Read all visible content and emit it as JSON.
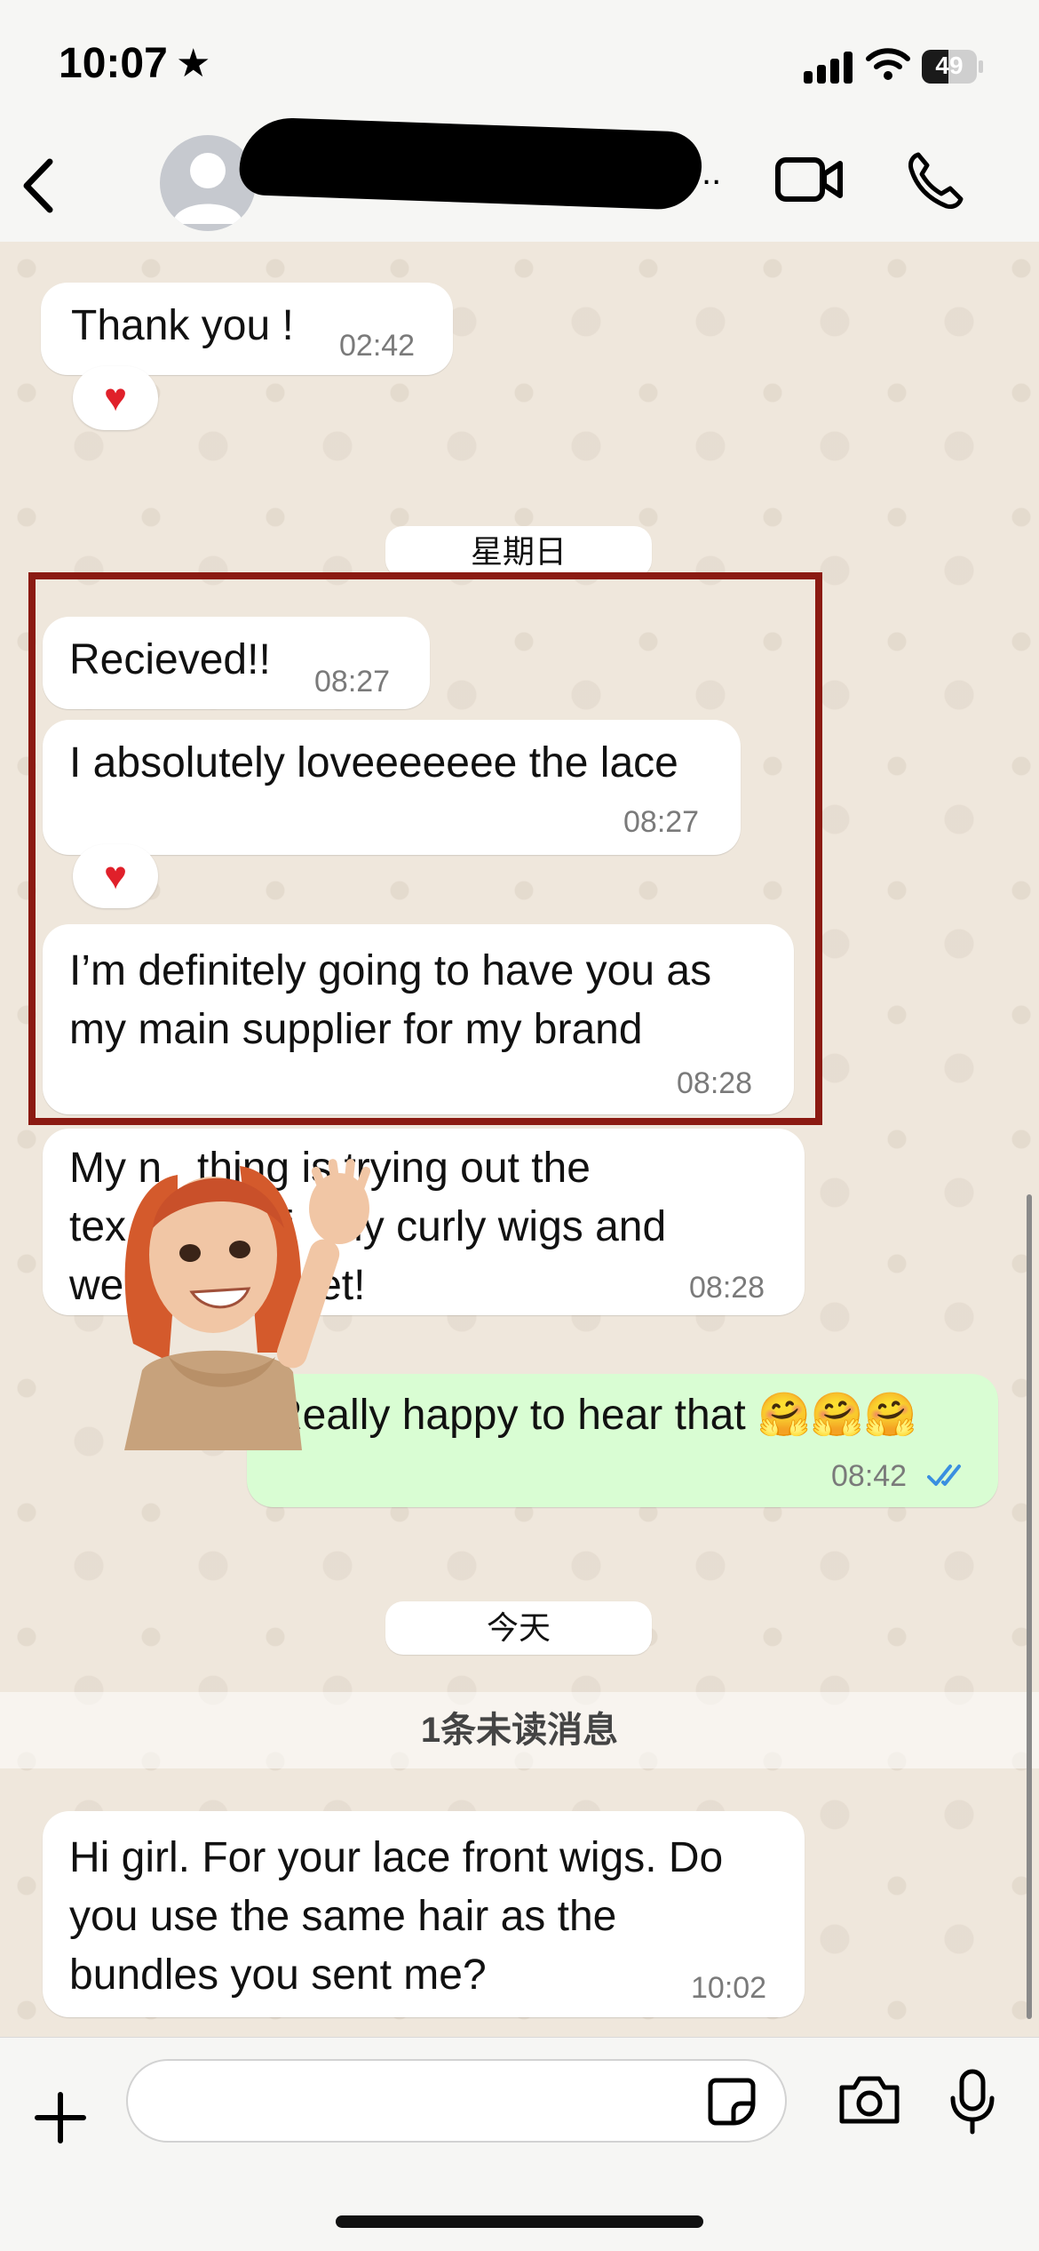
{
  "status_bar": {
    "time": "10:07",
    "battery": "49",
    "battery_level": 0.49
  },
  "header": {
    "back_icon": "chevron-left-icon",
    "more": "..",
    "video_icon": "video-icon",
    "call_icon": "phone-icon"
  },
  "chat": {
    "messages": [
      {
        "text": "Thank you !",
        "time": "02:42",
        "reaction": "♥"
      },
      {
        "date": "星期日"
      },
      {
        "text": "Recieved!!",
        "time": "08:27"
      },
      {
        "text": "I absolutely loveeeeeee the lace",
        "time": "08:27",
        "reaction": "♥"
      },
      {
        "text": "I’m definitely going to have you as\nmy main supplier for my brand",
        "time": "08:28"
      },
      {
        "text": "My n   thing is trying out the\ntex        air f   my curly wigs and\nwe        ull s  et!",
        "time": "08:28"
      },
      {
        "text": "Really happy to hear that 🤗🤗🤗",
        "time": "08:42",
        "outgoing": true,
        "read": true
      },
      {
        "date": "今天"
      },
      {
        "unread": "1条未读消息"
      },
      {
        "text": "Hi girl. For your lace front wigs. Do\nyou use the same hair as the\nbundles you sent me?",
        "time": "10:02"
      }
    ]
  },
  "colors": {
    "highlight": "#8b1a12",
    "outgoing_bubble": "#d9fdd3",
    "read_tick": "#3a8fe0",
    "reaction": "#e0202a"
  },
  "input_bar": {
    "plus_icon": "plus-icon",
    "sticker_icon": "sticker-icon",
    "camera_icon": "camera-icon",
    "mic_icon": "microphone-icon"
  }
}
